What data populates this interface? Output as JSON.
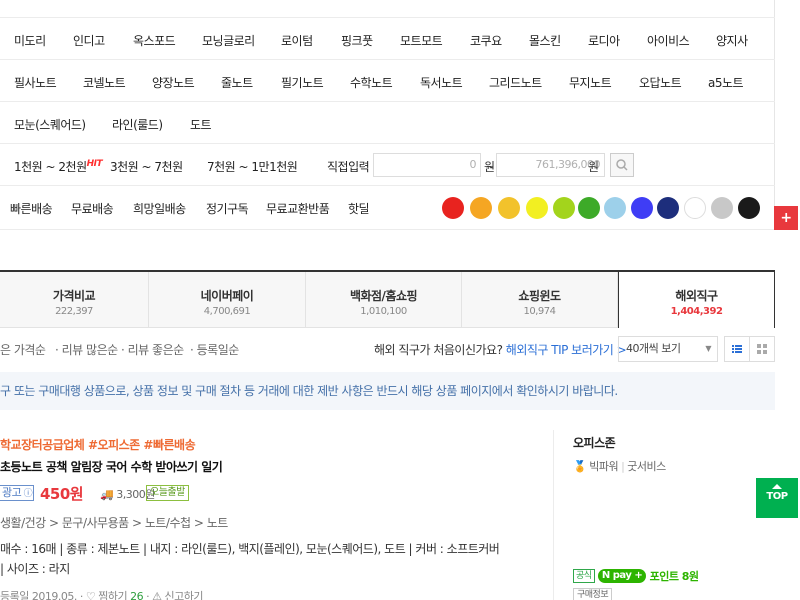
{
  "filters": {
    "brands_row1": [
      "미도리",
      "인디고",
      "옥스포드",
      "모닝글로리",
      "로이텀",
      "핑크풋",
      "모트모트",
      "코쿠요",
      "몰스킨",
      "로디아",
      "아이비스",
      "양지사"
    ],
    "types_row": [
      "필사노트",
      "코넬노트",
      "양장노트",
      "줄노트",
      "필기노트",
      "수학노트",
      "독서노트",
      "그리드노트",
      "무지노트",
      "오답노트",
      "a5노트"
    ],
    "inner_row": [
      "모눈(스퀘어드)",
      "라인(룰드)",
      "도트"
    ],
    "price": {
      "range1": "1천원 ~ 2천원",
      "hit": "HIT",
      "range2": "3천원 ~ 7천원",
      "range3": "7천원 ~ 1만1천원",
      "direct_label": "직접입력",
      "min_placeholder": "0",
      "max_placeholder": "761,396,000",
      "unit": "원",
      "tilde": "~"
    },
    "delivery": [
      "빠른배송",
      "무료배송",
      "희망일배송",
      "정기구독",
      "무료교환반품",
      "핫딜"
    ],
    "colors": [
      "#e8231f",
      "#f5a623",
      "#f2c22b",
      "#f2ef22",
      "#a3d41c",
      "#3daa28",
      "#9dd0ea",
      "#3f3df5",
      "#1d2e7c",
      "#ffffff",
      "#c8c8c8",
      "#1a1a1a"
    ],
    "plus": "+"
  },
  "tabs": [
    {
      "label": "가격비교",
      "count": "222,397"
    },
    {
      "label": "네이버페이",
      "count": "4,700,691"
    },
    {
      "label": "백화점/홈쇼핑",
      "count": "1,010,100"
    },
    {
      "label": "쇼핑윈도",
      "count": "10,974"
    },
    {
      "label": "해외직구",
      "count": "1,404,392"
    }
  ],
  "sort": {
    "items": [
      "은 가격순",
      "· 리뷰 많은순",
      "· 리뷰 좋은순",
      "· 등록일순"
    ],
    "question": "해외 직구가 처음이신가요?",
    "tip_link": "해외직구 TIP 보러가기 >",
    "page_size": "40개씩 보기"
  },
  "notice": "구 또는 구매대행 상품으로, 상품 정보 및 구매 절차 등 거래에 대한 제반 사항은 반드시 해당 상품 페이지에서 확인하시기 바랍니다.",
  "product": {
    "hashtags": "학교장터공급업체 #오피스존 #빠른배송",
    "title": "초등노트 공책 알림장 국어 수학 받아쓰기 일기",
    "ad": "광고",
    "price": "450원",
    "shipping": "3,300원",
    "today": "오늘출발",
    "category": "생활/건강 > 문구/사무용품 > 노트/수첩 > 노트",
    "specs1": "매수 : 16매   |   종류 : 제본노트   |   내지 : 라인(룰드), 백지(플레인), 모눈(스퀘어드), 도트   |   커버 : 소프트커버",
    "specs2": "|   사이즈 : 라지",
    "date": "등록일 2019.05.",
    "zzim_label": "찜하기",
    "zzim_count": "26",
    "report": "신고하기",
    "seller": "오피스존",
    "grade": "빅파워",
    "grade_sep": "|",
    "grade_extra": "굿서비스",
    "official": "공식",
    "npay": "pay",
    "point": "포인트 8원",
    "buy_info": "구매정보"
  },
  "top_button": "TOP"
}
